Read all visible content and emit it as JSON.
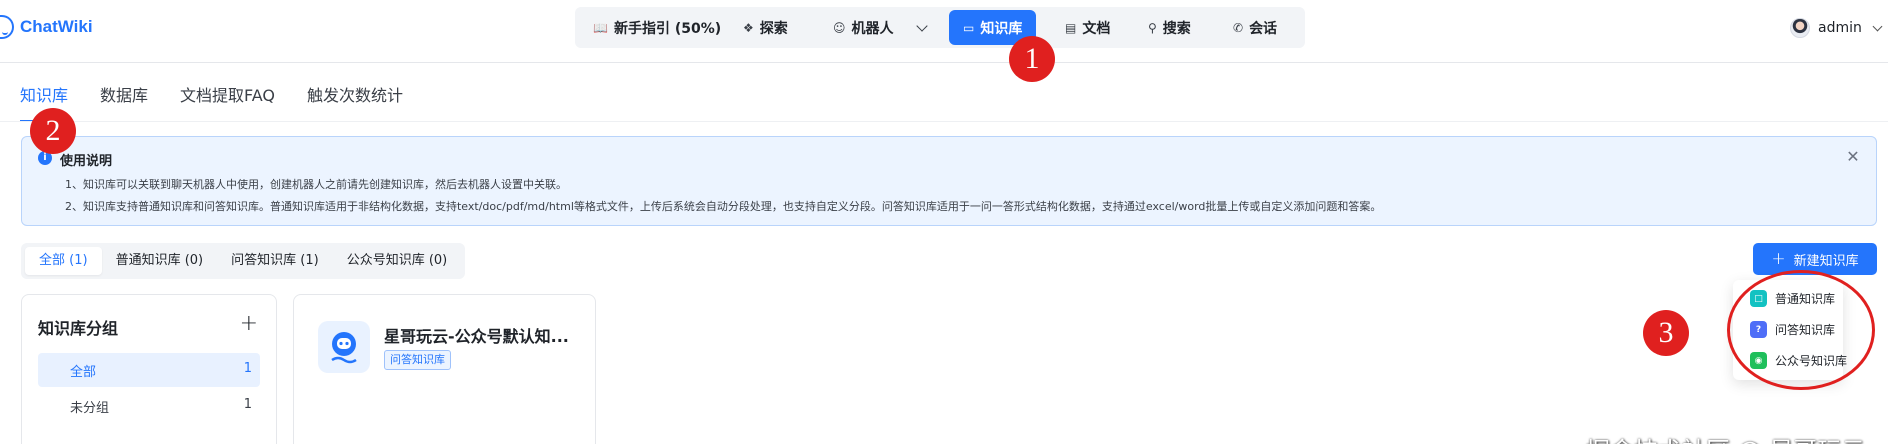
{
  "app": {
    "brand": "ChatWiki"
  },
  "nav": {
    "items": [
      {
        "label": "新手指引 (50%)",
        "icon": "book-icon"
      },
      {
        "label": "探索",
        "icon": "explore-icon"
      },
      {
        "label": "机器人",
        "icon": "robot-icon"
      },
      {
        "label": "知识库",
        "icon": "knowledge-icon"
      },
      {
        "label": "文档",
        "icon": "document-icon"
      },
      {
        "label": "搜索",
        "icon": "search-icon"
      },
      {
        "label": "会话",
        "icon": "chat-icon"
      }
    ],
    "active": "知识库"
  },
  "user": {
    "name": "admin"
  },
  "tabs": [
    "知识库",
    "数据库",
    "文档提取FAQ",
    "触发次数统计"
  ],
  "notice": {
    "title": "使用说明",
    "lines": [
      "1、知识库可以关联到聊天机器人中使用，创建机器人之前请先创建知识库，然后去机器人设置中关联。",
      "2、知识库支持普通知识库和问答知识库。普通知识库适用于非结构化数据，支持text/doc/pdf/md/html等格式文件，上传后系统会自动分段处理，也支持自定义分段。问答知识库适用于一问一答形式结构化数据，支持通过excel/word批量上传或自定义添加问题和答案。"
    ]
  },
  "filters": [
    "全部 (1)",
    "普通知识库 (0)",
    "问答知识库 (1)",
    "公众号知识库 (0)"
  ],
  "create_button": {
    "label": "新建知识库"
  },
  "create_menu": [
    {
      "label": "普通知识库",
      "color": "#13c2c2"
    },
    {
      "label": "问答知识库",
      "color": "#4f6ef7"
    },
    {
      "label": "公众号知识库",
      "color": "#1fbf5b"
    }
  ],
  "groups": {
    "title": "知识库分组",
    "items": [
      {
        "label": "全部",
        "count": "1"
      },
      {
        "label": "未分组",
        "count": "1"
      }
    ]
  },
  "library_card": {
    "name": "星哥玩云-公众号默认知...",
    "tag": "问答知识库"
  },
  "annotations": [
    "1",
    "2",
    "3"
  ],
  "watermark": "掘金技术社区 @ 星哥玩云",
  "colors": {
    "accent": "#2475fc",
    "annotation": "#e0201f",
    "notice_bg": "#ecf4ff"
  }
}
